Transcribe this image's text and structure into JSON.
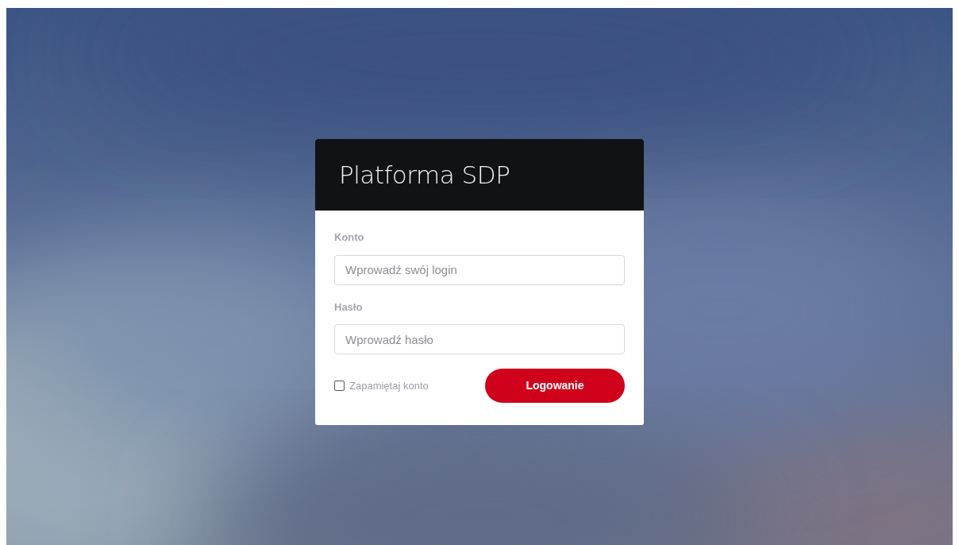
{
  "title": "Platforma SDP",
  "fields": [
    {
      "label": "Konto",
      "placeholder": "Wprowadź swój login"
    },
    {
      "label": "Hasło",
      "placeholder": "Wprowadź hasło"
    }
  ],
  "remember": {
    "label": "Zapamiętaj konto",
    "checked": false
  },
  "submit": "Logowanie"
}
